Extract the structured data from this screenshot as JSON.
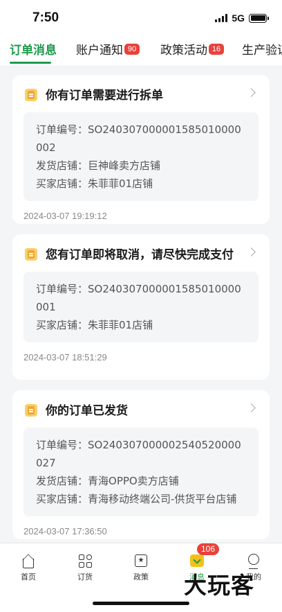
{
  "status_bar": {
    "time": "7:50",
    "network": "5G"
  },
  "tabs": [
    {
      "label": "订单消息",
      "active": true,
      "badge": ""
    },
    {
      "label": "账户通知",
      "active": false,
      "badge": "90"
    },
    {
      "label": "政策活动",
      "active": false,
      "badge": "16"
    },
    {
      "label": "生产验证",
      "active": false,
      "badge": ""
    }
  ],
  "messages": [
    {
      "title": "你有订单需要进行拆单",
      "order_no_label": "订单编号：",
      "order_no": "SO240307000001585010000002",
      "ship_store_label": "发货店铺：",
      "ship_store": "巨神峰卖方店铺",
      "buyer_store_label": "买家店铺：",
      "buyer_store": "朱菲菲01店铺",
      "time": "2024-03-07 19:19:12"
    },
    {
      "title": "您有订单即将取消，请尽快完成支付",
      "order_no_label": "订单编号：",
      "order_no": "SO240307000001585010000001",
      "buyer_store_label": "买家店铺：",
      "buyer_store": "朱菲菲01店铺",
      "time": "2024-03-07 18:51:29"
    },
    {
      "title": "你的订单已发货",
      "order_no_label": "订单编号：",
      "order_no": "SO240307000002540520000027",
      "ship_store_label": "发货店铺：",
      "ship_store": "青海OPPO卖方店铺",
      "buyer_store_label": "买家店铺：",
      "buyer_store": "青海移动终端公司-供货平台店铺",
      "time": "2024-03-07 17:36:50"
    }
  ],
  "bottom_nav": {
    "items": [
      {
        "label": "首页",
        "icon": "home-icon"
      },
      {
        "label": "订货",
        "icon": "grid-icon"
      },
      {
        "label": "政策",
        "icon": "policy-icon"
      },
      {
        "label": "消息",
        "icon": "message-icon"
      },
      {
        "label": "我的",
        "icon": "profile-icon"
      }
    ],
    "message_badge": "106"
  },
  "watermark": "大玩客",
  "colors": {
    "accent": "#1e9a4d",
    "badge": "#e8413b"
  }
}
